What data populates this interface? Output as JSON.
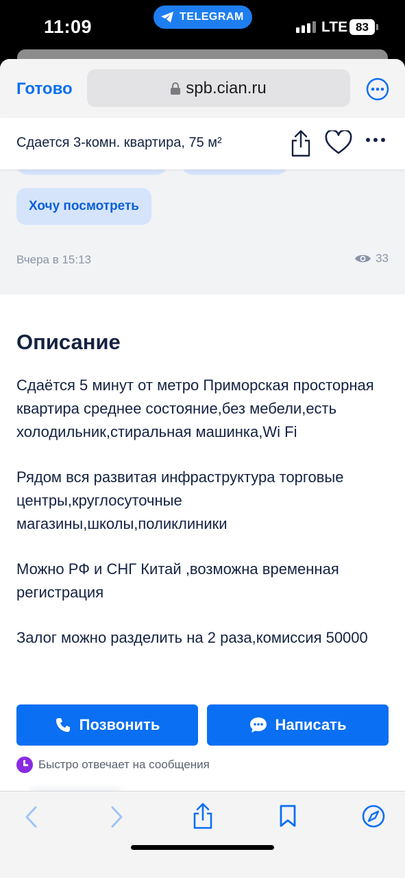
{
  "status_bar": {
    "time": "11:09",
    "telegram_pill": "TELEGRAM",
    "network": "LTE",
    "battery": "83"
  },
  "browser": {
    "done_label": "Готово",
    "url": "spb.cian.ru"
  },
  "listing": {
    "title": "Сдается 3-комн. квартира, 75 м²",
    "chip_label": "Хочу посмотреть",
    "posted": "Вчера в 15:13",
    "views": "33"
  },
  "description": {
    "heading": "Описание",
    "paragraphs": [
      "Сдаётся 5 минут от метро Приморская просторная квартира среднее состояние,без мебели,есть холодильник,стиральная машинка,Wi Fi",
      "Рядом вся развитая инфраструктура торговые центры,круглосуточные магазины,школы,поликлиники",
      "Можно РФ и СНГ Китай ,возможна временная регистрация",
      "Залог можно разделить на 2 раза,комиссия 50000"
    ]
  },
  "actions": {
    "call_label": "Позвонить",
    "write_label": "Написать",
    "fast_reply": "Быстро отвечает на сообщения"
  },
  "colors": {
    "accent": "#0a6ff2",
    "chip_bg": "#d5e4fb",
    "text_dark": "#152242",
    "muted": "#8b94a6",
    "badge_purple": "#8a2be2"
  }
}
